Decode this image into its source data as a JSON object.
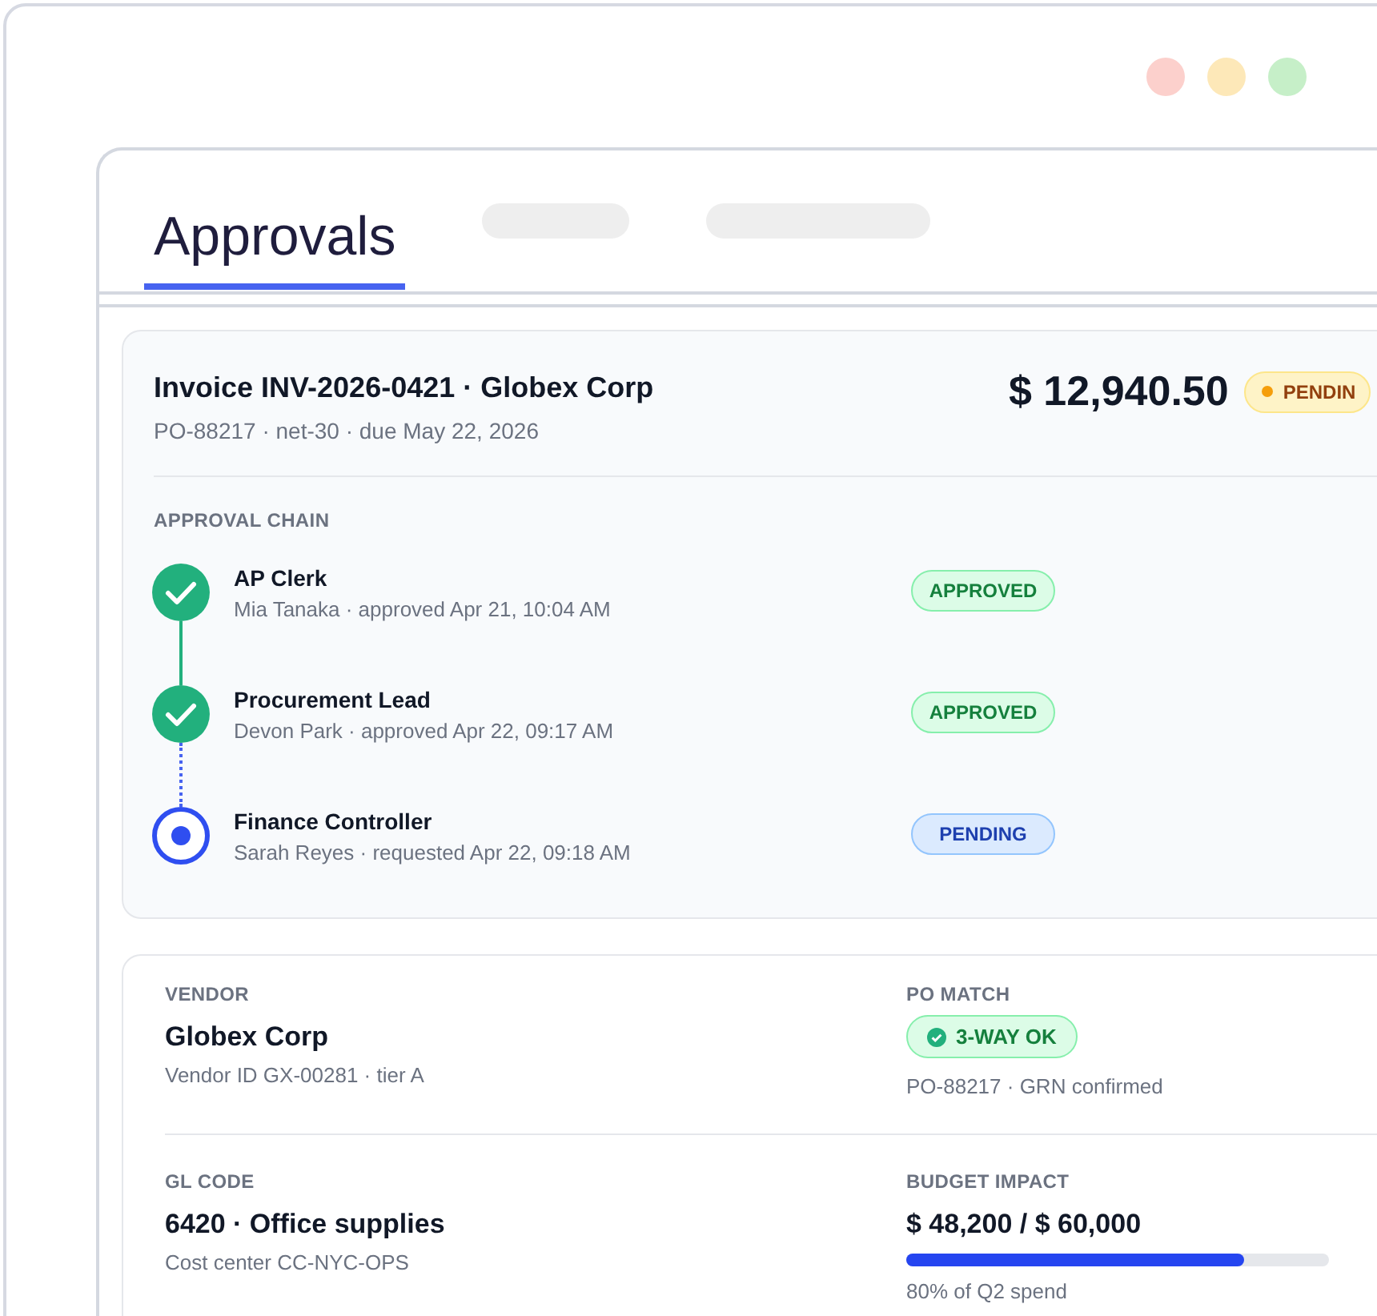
{
  "window": {
    "controls": [
      {
        "color": "#fcd0cc"
      },
      {
        "color": "#fde8b8"
      },
      {
        "color": "#c6efc8"
      }
    ]
  },
  "tabs": [
    {
      "label": "Approvals",
      "selected": true
    },
    {
      "kind": "placeholder",
      "selected": false
    },
    {
      "kind": "placeholder",
      "selected": false
    }
  ],
  "invoice": {
    "title": "Invoice INV-2026-0421 · Globex Corp",
    "meta": "PO-88217 · net-30 · due May 22, 2026",
    "amount": "$ 12,940.50",
    "status": {
      "label": "PENDIN",
      "kind": "pending"
    }
  },
  "approval_chain": {
    "heading": "APPROVAL CHAIN",
    "steps": [
      {
        "role": "AP Clerk",
        "detail": "Mia Tanaka · approved Apr 21, 10:04 AM",
        "kind": "approved",
        "badge": "APPROVED"
      },
      {
        "role": "Procurement Lead",
        "detail": "Devon Park · approved Apr 22, 09:17 AM",
        "kind": "approved",
        "badge": "APPROVED"
      },
      {
        "role": "Finance Controller",
        "detail": "Sarah Reyes · requested Apr 22, 09:18 AM",
        "kind": "pending",
        "badge": "PENDING"
      }
    ]
  },
  "details": [
    {
      "label": "VENDOR",
      "value": "Globex Corp",
      "sub": "Vendor ID GX-00281 · tier A",
      "kind": "text"
    },
    {
      "label": "PO MATCH",
      "badge": "3-WAY OK",
      "sub": "PO-88217 · GRN confirmed",
      "kind": "badge"
    },
    {
      "label": "GL CODE",
      "value": "6420 · Office supplies",
      "sub": "Cost center CC-NYC-OPS",
      "kind": "text"
    },
    {
      "label": "BUDGET IMPACT",
      "value": "$ 48,200 / $ 60,000",
      "level": 0.8,
      "sub": "80% of Q2 spend",
      "kind": "meter"
    }
  ]
}
